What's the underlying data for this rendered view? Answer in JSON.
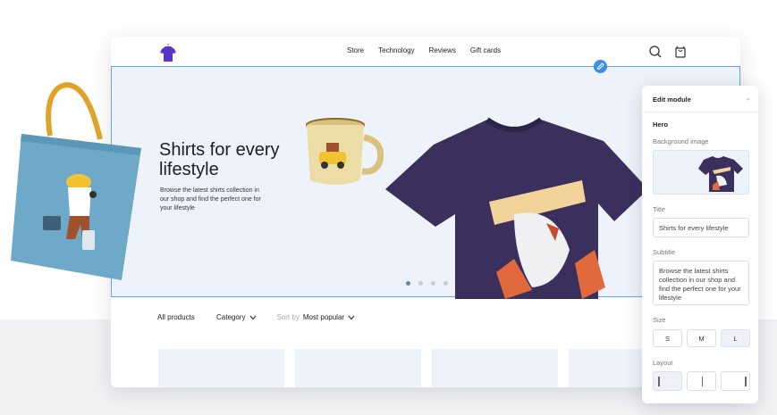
{
  "nav": {
    "items": [
      "Store",
      "Technology",
      "Reviews",
      "Gift cards"
    ],
    "logo_icon": "tshirt-logo-icon",
    "search_icon": "search-icon",
    "bag_icon": "shopping-bag-icon"
  },
  "hero": {
    "title": "Shirts for every lifestyle",
    "subtitle": "Browse the latest shirts collection in our shop and find the perfect one for your lifestyle",
    "slide_count": 4,
    "active_slide": 1
  },
  "filters": {
    "all_products": "All products",
    "category": "Category",
    "sort_label": "Sort by",
    "sort_value": "Most popular"
  },
  "panel": {
    "title": "Edit module",
    "section": "Hero",
    "background_label": "Background image",
    "title_label": "Title",
    "title_value": "Shirts for every lifestyle",
    "subtitle_label": "Subtitle",
    "subtitle_value": "Browse the latest shirts collection in our shop and find the perfect one for your lifestyle",
    "size_label": "Size",
    "sizes": [
      "S",
      "M",
      "L"
    ],
    "selected_size": "L",
    "layout_label": "Layout",
    "selected_layout": 1
  },
  "colors": {
    "accent": "#3d8ef0",
    "shirt": "#3b2f5e",
    "tote": "#6fa9c9",
    "hero_bg": "#eef3fb"
  }
}
